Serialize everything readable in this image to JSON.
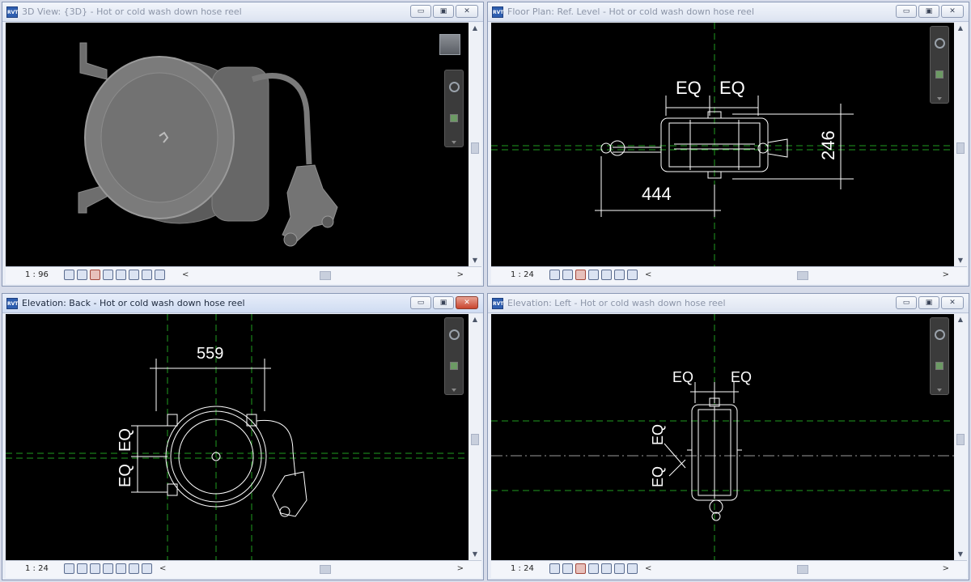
{
  "viewports": {
    "v3d": {
      "title": "3D View: {3D} - Hot or cold wash down hose reel",
      "scale": "1 : 96"
    },
    "plan": {
      "title": "Floor Plan: Ref. Level - Hot or cold wash down hose reel",
      "scale": "1 : 24",
      "dim_eq1": "EQ",
      "dim_eq2": "EQ",
      "dim_width": "444",
      "dim_height": "246"
    },
    "back": {
      "title": "Elevation: Back - Hot or cold wash down hose reel",
      "scale": "1 : 24",
      "dim_width": "559",
      "dim_eq1": "EQ",
      "dim_eq2": "EQ"
    },
    "left": {
      "title": "Elevation: Left - Hot or cold wash down hose reel",
      "scale": "1 : 24",
      "dim_eq1": "EQ",
      "dim_eq2": "EQ",
      "dim_eq3": "EQ",
      "dim_eq4": "EQ"
    }
  },
  "window_buttons": {
    "minimize": "▭",
    "restore": "▣",
    "close": "✕"
  },
  "scroll": {
    "left": "<",
    "right": ">",
    "up": "▲",
    "down": "▼"
  },
  "icons": [
    "revit-file-icon",
    "view-cube-icon",
    "steering-wheel-icon",
    "zoom-icon"
  ],
  "colors": {
    "canvas": "#000000",
    "reference_plane": "#1f9c1f",
    "model": "#ffffff",
    "active_close": "#c9452f"
  }
}
